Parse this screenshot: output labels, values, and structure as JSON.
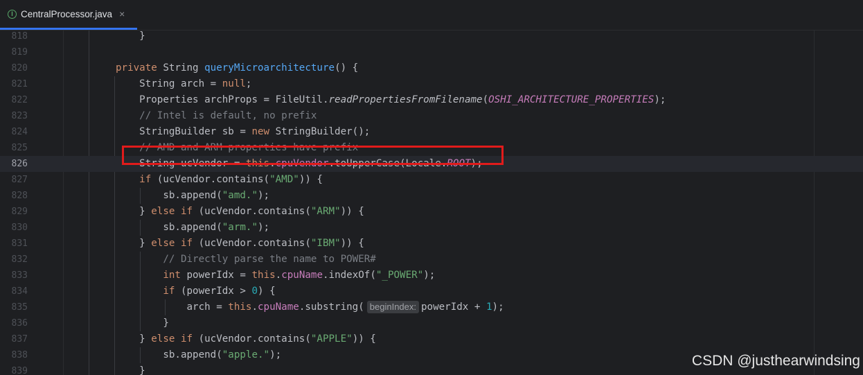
{
  "tab": {
    "icon": "java-interface-icon",
    "icon_letter": "I",
    "label": "CentralProcessor.java",
    "close": "×"
  },
  "lines": [
    {
      "num": "818",
      "tokens": [
        {
          "t": "    }",
          "c": ""
        }
      ]
    },
    {
      "num": "819",
      "tokens": []
    },
    {
      "num": "820",
      "tokens": [
        {
          "t": "private ",
          "c": "kw"
        },
        {
          "t": "String ",
          "c": ""
        },
        {
          "t": "queryMicroarchitecture",
          "c": "fn"
        },
        {
          "t": "() {",
          "c": ""
        }
      ]
    },
    {
      "num": "821",
      "tokens": [
        {
          "t": "    String arch = ",
          "c": ""
        },
        {
          "t": "null",
          "c": "kw"
        },
        {
          "t": ";",
          "c": ""
        }
      ]
    },
    {
      "num": "822",
      "tokens": [
        {
          "t": "    Properties archProps = FileUtil.",
          "c": ""
        },
        {
          "t": "readPropertiesFromFilename",
          "c": "sfn"
        },
        {
          "t": "(",
          "c": ""
        },
        {
          "t": "OSHI_ARCHITECTURE_PROPERTIES",
          "c": "fld it"
        },
        {
          "t": ");",
          "c": ""
        }
      ]
    },
    {
      "num": "823",
      "tokens": [
        {
          "t": "    // Intel is default, no prefix",
          "c": "cm"
        }
      ]
    },
    {
      "num": "824",
      "tokens": [
        {
          "t": "    StringBuilder sb = ",
          "c": ""
        },
        {
          "t": "new ",
          "c": "kw"
        },
        {
          "t": "StringBuilder();",
          "c": ""
        }
      ]
    },
    {
      "num": "825",
      "tokens": [
        {
          "t": "    // AMD and ARM properties have prefix",
          "c": "cm"
        }
      ]
    },
    {
      "num": "826",
      "current": true,
      "tokens": [
        {
          "t": "    String ucVendor = ",
          "c": ""
        },
        {
          "t": "this",
          "c": "kw"
        },
        {
          "t": ".",
          "c": ""
        },
        {
          "t": "cpuVendor",
          "c": "fld"
        },
        {
          "t": ".toUpperCase(Locale.",
          "c": ""
        },
        {
          "t": "ROOT",
          "c": "fld it"
        },
        {
          "t": ");",
          "c": ""
        }
      ]
    },
    {
      "num": "827",
      "tokens": [
        {
          "t": "    ",
          "c": ""
        },
        {
          "t": "if ",
          "c": "kw"
        },
        {
          "t": "(ucVendor.contains(",
          "c": ""
        },
        {
          "t": "\"AMD\"",
          "c": "st"
        },
        {
          "t": ")) {",
          "c": ""
        }
      ]
    },
    {
      "num": "828",
      "tokens": [
        {
          "t": "        sb.append(",
          "c": ""
        },
        {
          "t": "\"amd.\"",
          "c": "st"
        },
        {
          "t": ");",
          "c": ""
        }
      ]
    },
    {
      "num": "829",
      "tokens": [
        {
          "t": "    } ",
          "c": ""
        },
        {
          "t": "else if ",
          "c": "kw"
        },
        {
          "t": "(ucVendor.contains(",
          "c": ""
        },
        {
          "t": "\"ARM\"",
          "c": "st"
        },
        {
          "t": ")) {",
          "c": ""
        }
      ]
    },
    {
      "num": "830",
      "tokens": [
        {
          "t": "        sb.append(",
          "c": ""
        },
        {
          "t": "\"arm.\"",
          "c": "st"
        },
        {
          "t": ");",
          "c": ""
        }
      ]
    },
    {
      "num": "831",
      "tokens": [
        {
          "t": "    } ",
          "c": ""
        },
        {
          "t": "else if ",
          "c": "kw"
        },
        {
          "t": "(ucVendor.contains(",
          "c": ""
        },
        {
          "t": "\"IBM\"",
          "c": "st"
        },
        {
          "t": ")) {",
          "c": ""
        }
      ]
    },
    {
      "num": "832",
      "tokens": [
        {
          "t": "        // Directly parse the name to POWER#",
          "c": "cm"
        }
      ]
    },
    {
      "num": "833",
      "tokens": [
        {
          "t": "        ",
          "c": ""
        },
        {
          "t": "int ",
          "c": "kw"
        },
        {
          "t": "powerIdx = ",
          "c": ""
        },
        {
          "t": "this",
          "c": "kw"
        },
        {
          "t": ".",
          "c": ""
        },
        {
          "t": "cpuName",
          "c": "fld"
        },
        {
          "t": ".indexOf(",
          "c": ""
        },
        {
          "t": "\"_POWER\"",
          "c": "st"
        },
        {
          "t": ");",
          "c": ""
        }
      ]
    },
    {
      "num": "834",
      "tokens": [
        {
          "t": "        ",
          "c": ""
        },
        {
          "t": "if ",
          "c": "kw"
        },
        {
          "t": "(powerIdx > ",
          "c": ""
        },
        {
          "t": "0",
          "c": "num"
        },
        {
          "t": ") {",
          "c": ""
        }
      ]
    },
    {
      "num": "835",
      "tokens": [
        {
          "t": "            arch = ",
          "c": ""
        },
        {
          "t": "this",
          "c": "kw"
        },
        {
          "t": ".",
          "c": ""
        },
        {
          "t": "cpuName",
          "c": "fld"
        },
        {
          "t": ".substring(",
          "c": ""
        },
        {
          "t": "beginIndex:",
          "c": "hint"
        },
        {
          "t": "powerIdx + ",
          "c": ""
        },
        {
          "t": "1",
          "c": "num"
        },
        {
          "t": ");",
          "c": ""
        }
      ]
    },
    {
      "num": "836",
      "tokens": [
        {
          "t": "        }",
          "c": ""
        }
      ]
    },
    {
      "num": "837",
      "tokens": [
        {
          "t": "    } ",
          "c": ""
        },
        {
          "t": "else if ",
          "c": "kw"
        },
        {
          "t": "(ucVendor.contains(",
          "c": ""
        },
        {
          "t": "\"APPLE\"",
          "c": "st"
        },
        {
          "t": ")) {",
          "c": ""
        }
      ]
    },
    {
      "num": "838",
      "tokens": [
        {
          "t": "        sb.append(",
          "c": ""
        },
        {
          "t": "\"apple.\"",
          "c": "st"
        },
        {
          "t": ");",
          "c": ""
        }
      ]
    },
    {
      "num": "839",
      "tokens": [
        {
          "t": "    }",
          "c": ""
        }
      ]
    }
  ],
  "watermark": "CSDN @justhearwindsing",
  "colors": {
    "background": "#1e1f22",
    "keyword": "#cf8e6d",
    "function": "#56a8f5",
    "field": "#c77dbb",
    "string": "#6aab73",
    "number": "#2aacb8",
    "comment": "#7a7e85",
    "highlight_box": "#e11b1b",
    "tab_underline": "#3574f0"
  }
}
